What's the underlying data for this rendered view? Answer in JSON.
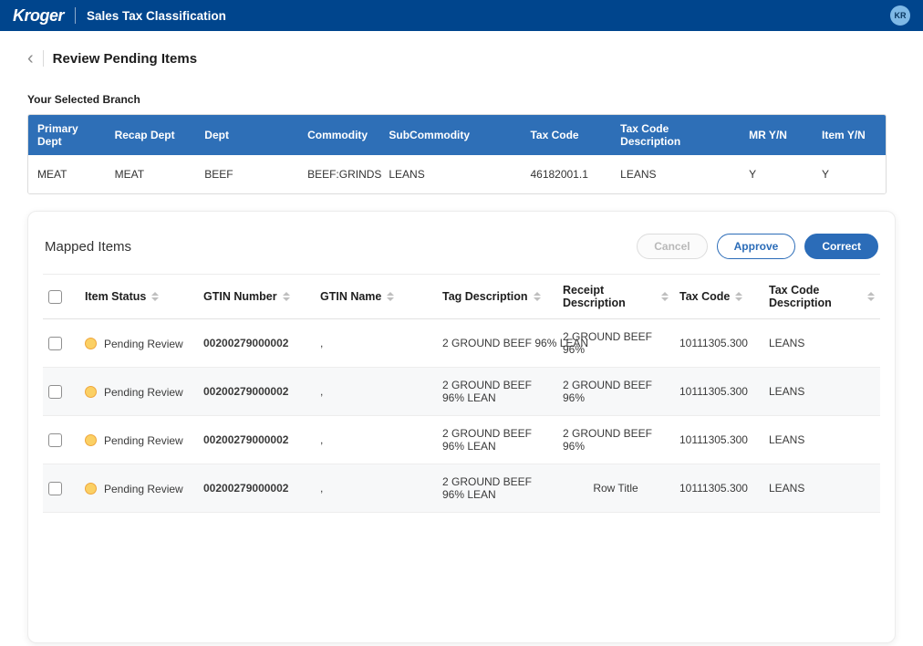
{
  "topbar": {
    "brand": "Kroger",
    "title": "Sales Tax Classification",
    "avatar_initials": "KR"
  },
  "page": {
    "back_icon": "‹",
    "title": "Review Pending Items",
    "branch_label": "Your Selected Branch"
  },
  "branch_table": {
    "columns": [
      "Primary Dept",
      "Recap Dept",
      "Dept",
      "Commodity",
      "SubCommodity",
      "Tax Code",
      "Tax Code Description",
      "MR Y/N",
      "Item Y/N"
    ],
    "row": [
      "MEAT",
      "MEAT",
      "BEEF",
      "BEEF:GRINDS",
      "LEANS",
      "46182001.1",
      "LEANS",
      "Y",
      "Y"
    ]
  },
  "mapped": {
    "title": "Mapped Items",
    "cancel_label": "Cancel",
    "approve_label": "Approve",
    "correct_label": "Correct",
    "columns": [
      "Item Status",
      "GTIN Number",
      "GTIN Name",
      "Tag Description",
      "Receipt Description",
      "Tax Code",
      "Tax Code Description"
    ],
    "rows": [
      {
        "status": "Pending Review",
        "gtin": "00200279000002",
        "gtin_name": ",",
        "tag": "2 GROUND BEEF 96% LEAN",
        "receipt": "2 GROUND BEEF 96%",
        "tax_code": "10111305.300",
        "tax_code_description": "LEANS"
      },
      {
        "status": "Pending Review",
        "gtin": "00200279000002",
        "gtin_name": ",",
        "tag": "2 GROUND BEEF 96% LEAN",
        "receipt": "2 GROUND BEEF 96%",
        "tax_code": "10111305.300",
        "tax_code_description": "LEANS"
      },
      {
        "status": "Pending Review",
        "gtin": "00200279000002",
        "gtin_name": ",",
        "tag": "2 GROUND BEEF 96% LEAN",
        "receipt": "2 GROUND BEEF 96%",
        "tax_code": "10111305.300",
        "tax_code_description": "LEANS"
      },
      {
        "status": "Pending Review",
        "gtin": "00200279000002",
        "gtin_name": ",",
        "tag": "2 GROUND BEEF 96% LEAN",
        "receipt": "Row Title",
        "tax_code": "10111305.300",
        "tax_code_description": "LEANS"
      }
    ]
  },
  "icons": {
    "back": "chevron-left",
    "sort": "caret-up-down",
    "status": "pending-dot"
  },
  "colors": {
    "topbar": "#00458d",
    "table_header": "#2e6fb7",
    "accent": "#2b6cb8",
    "pending_fill": "#fbd064",
    "pending_border": "#efa63d"
  }
}
